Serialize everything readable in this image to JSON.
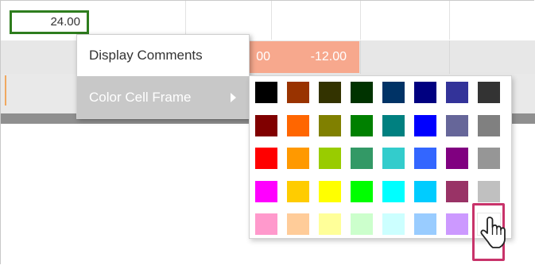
{
  "grid": {
    "selected_cell_value": "24.00",
    "negative_cell_value": "-12.00",
    "partial_cell_value": "00"
  },
  "context_menu": {
    "items": [
      {
        "label": "Display Comments"
      },
      {
        "label": "Color Cell Frame",
        "has_submenu": true,
        "highlighted": true
      }
    ]
  },
  "palette": {
    "rows": [
      [
        "#000000",
        "#993300",
        "#333300",
        "#003300",
        "#003366",
        "#000080",
        "#333399",
        "#333333"
      ],
      [
        "#800000",
        "#FF6600",
        "#808000",
        "#008000",
        "#008080",
        "#0000FF",
        "#666699",
        "#808080"
      ],
      [
        "#FF0000",
        "#FF9900",
        "#99CC00",
        "#339966",
        "#33CCCC",
        "#3366FF",
        "#800080",
        "#969696"
      ],
      [
        "#FF00FF",
        "#FFCC00",
        "#FFFF00",
        "#00FF00",
        "#00FFFF",
        "#00CCFF",
        "#993366",
        "#C0C0C0"
      ],
      [
        "#FF99CC",
        "#FFCC99",
        "#FFFF99",
        "#CCFFCC",
        "#CCFFFF",
        "#99CCFF",
        "#CC99FF",
        "#FFFFFF"
      ]
    ],
    "highlighted_swatch": "#FFFFFF",
    "highlight_color": "#C8336A"
  },
  "icons": {
    "cursor": "hand-pointer-icon",
    "submenu_arrow": "chevron-right-icon"
  }
}
